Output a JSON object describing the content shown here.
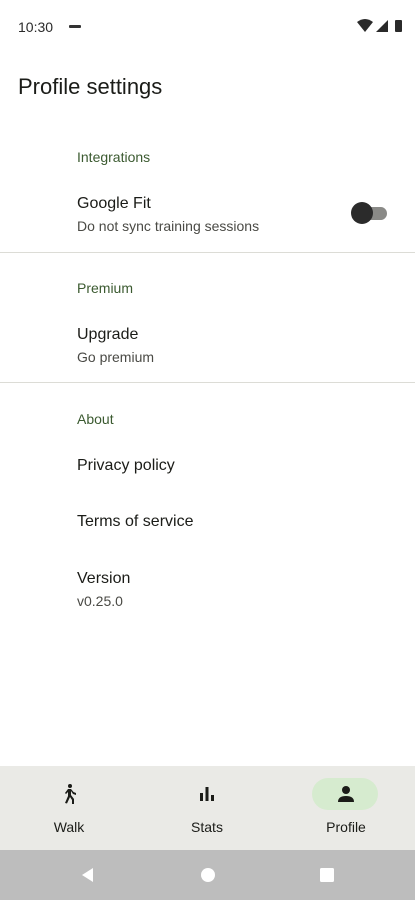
{
  "status_bar": {
    "time": "10:30"
  },
  "page": {
    "title": "Profile settings"
  },
  "sections": {
    "integrations": {
      "header": "Integrations",
      "google_fit": {
        "title": "Google Fit",
        "summary": "Do not sync training sessions",
        "enabled": false
      }
    },
    "premium": {
      "header": "Premium",
      "upgrade": {
        "title": "Upgrade",
        "summary": "Go premium"
      }
    },
    "about": {
      "header": "About",
      "privacy": {
        "title": "Privacy policy"
      },
      "terms": {
        "title": "Terms of service"
      },
      "version": {
        "title": "Version",
        "summary": "v0.25.0"
      }
    }
  },
  "bottom_nav": {
    "items": [
      {
        "label": "Walk",
        "icon": "walk-icon"
      },
      {
        "label": "Stats",
        "icon": "bar-chart-icon"
      },
      {
        "label": "Profile",
        "icon": "person-icon",
        "active": true
      }
    ]
  },
  "colors": {
    "accent_header": "#3b5a30",
    "active_pill": "#d6ebcf",
    "nav_background": "#eaeae6",
    "system_nav_background": "#bdbdbd"
  }
}
